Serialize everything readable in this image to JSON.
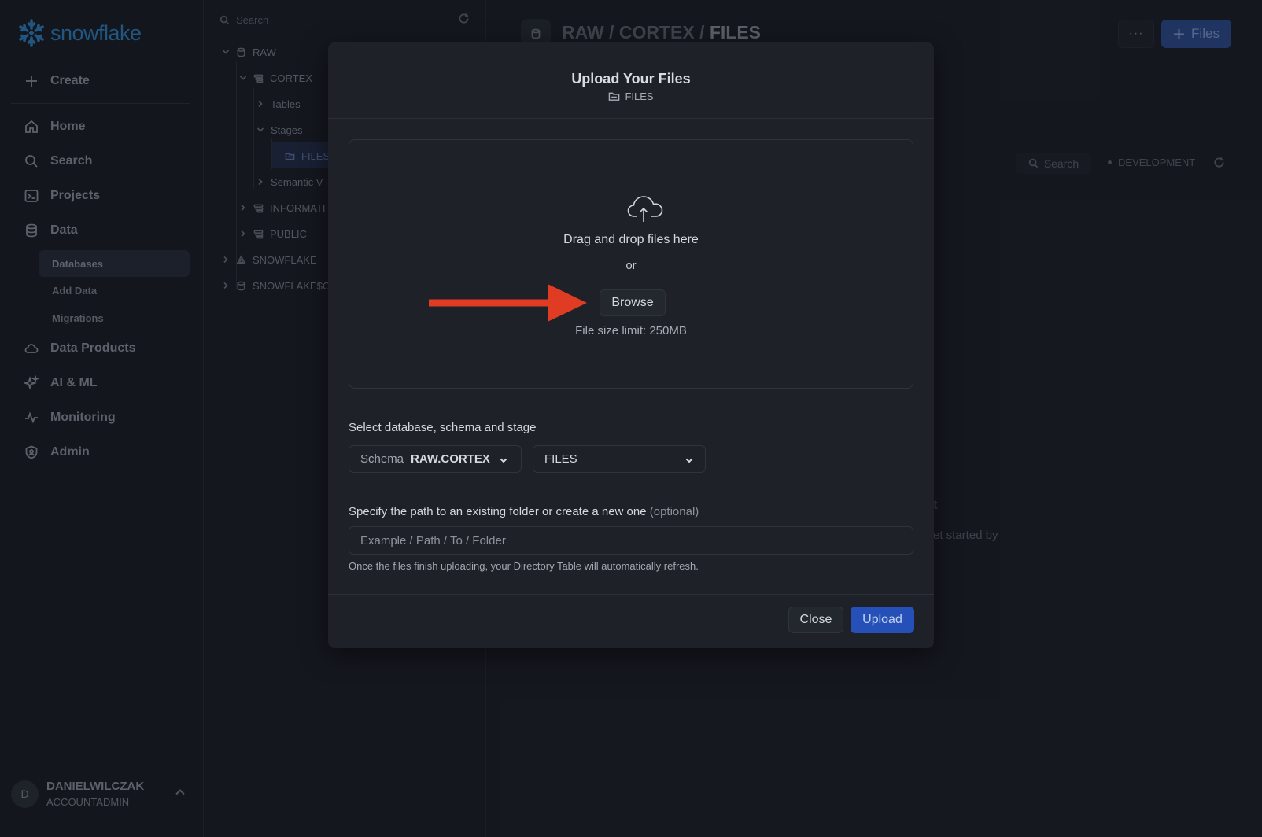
{
  "app": {
    "logo_text": "snowflake",
    "brand_color": "#2f7fbf"
  },
  "nav": {
    "create": "Create",
    "items": [
      {
        "label": "Home",
        "icon": "home-icon"
      },
      {
        "label": "Search",
        "icon": "search-icon"
      },
      {
        "label": "Projects",
        "icon": "terminal-icon"
      },
      {
        "label": "Data",
        "icon": "database-icon"
      },
      {
        "label": "Data Products",
        "icon": "cloud-icon"
      },
      {
        "label": "AI & ML",
        "icon": "sparkle-icon"
      },
      {
        "label": "Monitoring",
        "icon": "pulse-icon"
      },
      {
        "label": "Admin",
        "icon": "shield-icon"
      }
    ],
    "data_subitems": [
      "Databases",
      "Add Data",
      "Migrations"
    ],
    "active_subitem": "Databases"
  },
  "user": {
    "initial": "D",
    "name": "DANIELWILCZAK",
    "role": "ACCOUNTADMIN"
  },
  "tree": {
    "search_placeholder": "Search",
    "nodes": {
      "raw": "RAW",
      "cortex": "CORTEX",
      "tables": "Tables",
      "stages": "Stages",
      "files": "FILES",
      "semantic": "Semantic V",
      "information": "INFORMATI",
      "public": "PUBLIC",
      "snowflake": "SNOWFLAKE",
      "snowflake_sample": "SNOWFLAKE$C"
    }
  },
  "main": {
    "breadcrumb_prefix": "RAW / CORTEX / ",
    "breadcrumb_last": "FILES",
    "more_label": "···",
    "files_button": "Files",
    "search_label": "Search",
    "environment": "DEVELOPMENT",
    "empty_heading": "t",
    "empty_text": "et started by"
  },
  "modal": {
    "title": "Upload Your Files",
    "stage_name": "FILES",
    "drop_text": "Drag and drop files here",
    "or_text": "or",
    "browse_label": "Browse",
    "limit_text": "File size limit: 250MB",
    "select_label": "Select database, schema and stage",
    "schema_prefix": "Schema",
    "schema_value": "RAW.CORTEX",
    "stage_value": "FILES",
    "path_label": "Specify the path to an existing folder or create a new one",
    "path_optional": "(optional)",
    "path_placeholder": "Example / Path / To / Folder",
    "path_value": "",
    "hint": "Once the files finish uploading, your Directory Table will automatically refresh.",
    "close_label": "Close",
    "upload_label": "Upload",
    "upload_color": "#2450b8",
    "annotation_arrow_color": "#e03c24"
  }
}
